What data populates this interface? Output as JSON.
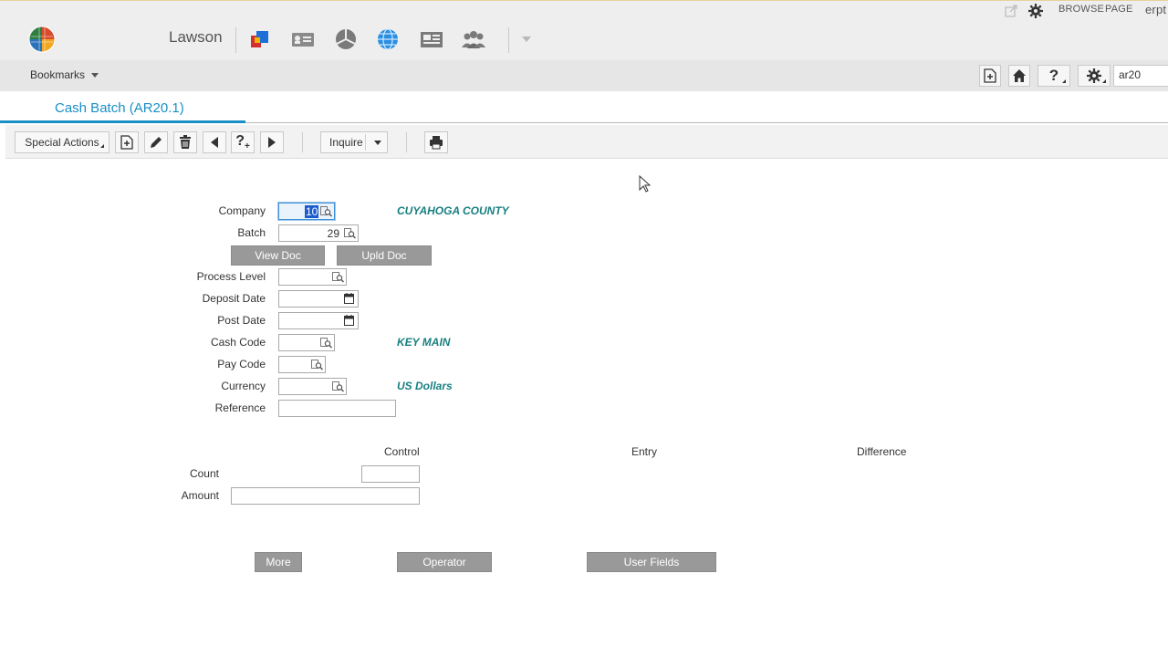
{
  "header": {
    "brand": "Lawson",
    "top_right": {
      "browse": "BROWSE",
      "page": "PAGE",
      "user": "erpt"
    },
    "bookmarks_label": "Bookmarks",
    "search_value": "ar20"
  },
  "tab": {
    "title": "Cash Batch (AR20.1)"
  },
  "toolbar": {
    "special_actions": "Special Actions",
    "inquire": "Inquire"
  },
  "form": {
    "company": {
      "label": "Company",
      "value": "10",
      "desc": "CUYAHOGA COUNTY"
    },
    "batch": {
      "label": "Batch",
      "value": "29"
    },
    "view_doc": "View Doc",
    "upld_doc": "Upld Doc",
    "process_level": {
      "label": "Process Level",
      "value": ""
    },
    "deposit_date": {
      "label": "Deposit Date",
      "value": ""
    },
    "post_date": {
      "label": "Post Date",
      "value": ""
    },
    "cash_code": {
      "label": "Cash Code",
      "value": "",
      "desc": "KEY MAIN"
    },
    "pay_code": {
      "label": "Pay Code",
      "value": ""
    },
    "currency": {
      "label": "Currency",
      "value": "",
      "desc": "US Dollars"
    },
    "reference": {
      "label": "Reference",
      "value": ""
    }
  },
  "totals": {
    "col_control": "Control",
    "col_entry": "Entry",
    "col_difference": "Difference",
    "count": {
      "label": "Count",
      "value": ""
    },
    "amount": {
      "label": "Amount",
      "value": ""
    }
  },
  "bottom_buttons": {
    "more": "More",
    "operator": "Operator",
    "user_fields": "User Fields"
  },
  "colors": {
    "accent": "#1a8fc4",
    "desc_text": "#187f80",
    "gray_button": "#999999"
  }
}
